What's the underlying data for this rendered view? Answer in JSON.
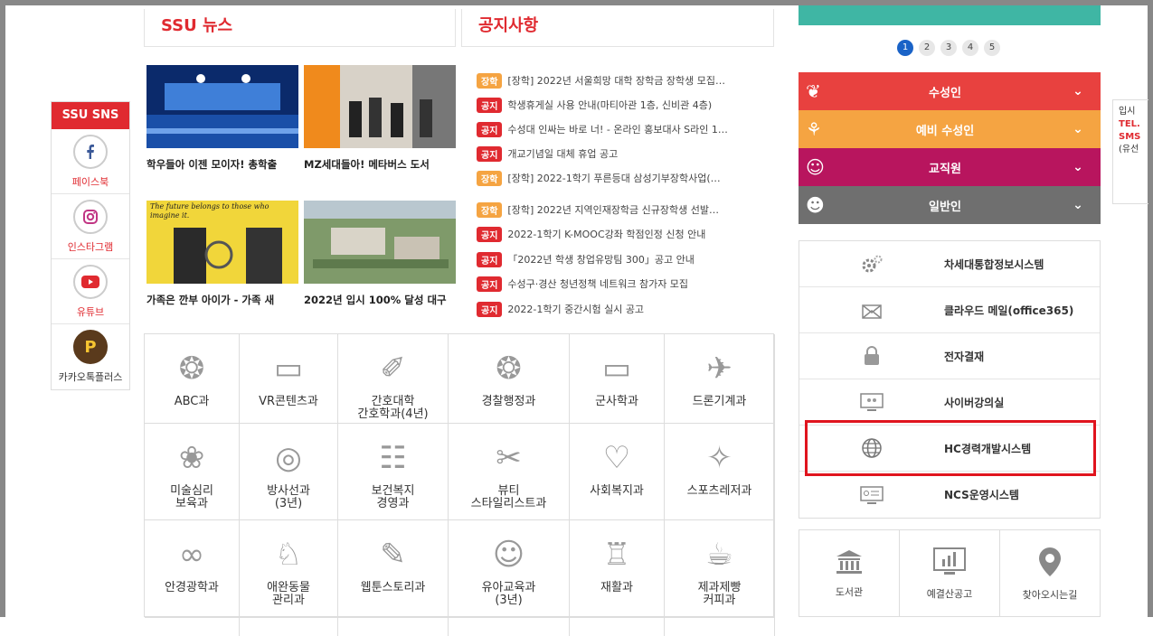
{
  "sns": {
    "title": "SSU SNS",
    "items": [
      {
        "label": "페이스북",
        "icon": "facebook-icon"
      },
      {
        "label": "인스타그램",
        "icon": "instagram-icon"
      },
      {
        "label": "유튜브",
        "icon": "youtube-icon"
      },
      {
        "label": "카카오톡플러스",
        "icon": "kakao-plus-icon"
      }
    ]
  },
  "news": {
    "title": "SSU 뉴스",
    "items": [
      {
        "caption": "학우들아 이젠 모이자! 총학출"
      },
      {
        "caption": "MZ세대들아! 메타버스 도서"
      },
      {
        "caption": "가족은 깐부 아이가 - 가족 새"
      },
      {
        "caption": "2022년 입시 100% 달성 대구"
      }
    ],
    "image_text": "The future belongs to those who imagine it."
  },
  "notices": {
    "title": "공지사항",
    "items": [
      {
        "badge": "장학",
        "type": "scholar",
        "text": "[장학] 2022년 서울희망 대학 장학금 장학생 모집…"
      },
      {
        "badge": "공지",
        "type": "notice",
        "text": "학생휴게실 사용 안내(마티아관 1층, 신비관 4층)"
      },
      {
        "badge": "공지",
        "type": "notice",
        "text": "수성대 인싸는 바로 너! - 온라인 홍보대사 S라인 1…"
      },
      {
        "badge": "공지",
        "type": "notice",
        "text": "개교기념일 대체 휴업 공고"
      },
      {
        "badge": "장학",
        "type": "scholar",
        "text": "[장학] 2022-1학기 푸른등대 삼성기부장학사업(…"
      },
      {
        "badge": "장학",
        "type": "scholar",
        "text": "[장학] 2022년 지역인재장학금 신규장학생 선발…"
      },
      {
        "badge": "공지",
        "type": "notice",
        "text": "2022-1학기 K-MOOC강좌 학점인정 신청 안내"
      },
      {
        "badge": "공지",
        "type": "notice",
        "text": "「2022년 학생 창업유망팀 300」공고 안내"
      },
      {
        "badge": "공지",
        "type": "notice",
        "text": "수성구·경산 청년정책 네트워크 참가자 모집"
      },
      {
        "badge": "공지",
        "type": "notice",
        "text": "2022-1학기 중간시험 실시 공고"
      }
    ]
  },
  "departments": [
    {
      "label": "ABC과",
      "icon": "head-circuit-icon"
    },
    {
      "label": "VR콘텐츠과",
      "icon": "vr-goggles-icon"
    },
    {
      "label": "간호대학\n간호학과(4년)",
      "icon": "syringe-icon"
    },
    {
      "label": "경찰행정과",
      "icon": "police-badge-icon"
    },
    {
      "label": "군사학과",
      "icon": "military-icon"
    },
    {
      "label": "드론기계과",
      "icon": "drone-icon"
    },
    {
      "label": "미술심리\n보육과",
      "icon": "palette-icon"
    },
    {
      "label": "방사선과\n(3년)",
      "icon": "mri-icon"
    },
    {
      "label": "보건복지\n경영과",
      "icon": "document-person-icon"
    },
    {
      "label": "뷰티\n스타일리스트과",
      "icon": "beauty-tools-icon"
    },
    {
      "label": "사회복지과",
      "icon": "heart-hands-icon"
    },
    {
      "label": "스포츠레저과",
      "icon": "muscle-icon"
    },
    {
      "label": "안경광학과",
      "icon": "glasses-icon"
    },
    {
      "label": "애완동물\n관리과",
      "icon": "dog-icon"
    },
    {
      "label": "웹툰스토리과",
      "icon": "pen-icon"
    },
    {
      "label": "유아교육과\n(3년)",
      "icon": "child-face-icon"
    },
    {
      "label": "재활과",
      "icon": "rehab-icon"
    },
    {
      "label": "제과제빵\n커피과",
      "icon": "bread-coffee-icon"
    }
  ],
  "pagination": {
    "pages": [
      "1",
      "2",
      "3",
      "4",
      "5"
    ],
    "active": 1
  },
  "roles": [
    {
      "label": "수성인",
      "color": "#e8413f",
      "icon": "boot-icon"
    },
    {
      "label": "예비 수성인",
      "color": "#f5a442",
      "icon": "plant-hand-icon"
    },
    {
      "label": "교직원",
      "color": "#b8155e",
      "icon": "staff-icon"
    },
    {
      "label": "일반인",
      "color": "#6f6f6f",
      "icon": "people-icon"
    }
  ],
  "systems": [
    {
      "label": "차세대통합정보시스템",
      "icon": "gears-icon"
    },
    {
      "label": "클라우드 메일(office365)",
      "icon": "mail-icon"
    },
    {
      "label": "전자결재",
      "icon": "lock-icon"
    },
    {
      "label": "사이버강의실",
      "icon": "monitor-icon"
    },
    {
      "label": "HC경력개발시스템",
      "icon": "globe-icon"
    },
    {
      "label": "NCS운영시스템",
      "icon": "screen-icon"
    }
  ],
  "quick": [
    {
      "label": "도서관",
      "icon": "library-icon"
    },
    {
      "label": "예결산공고",
      "icon": "chart-board-icon"
    },
    {
      "label": "찾아오시는길",
      "icon": "map-pin-icon"
    }
  ],
  "side_note": {
    "line1": "입시",
    "line2": "TEL.",
    "line3": "SMS",
    "line4": "(유선"
  }
}
